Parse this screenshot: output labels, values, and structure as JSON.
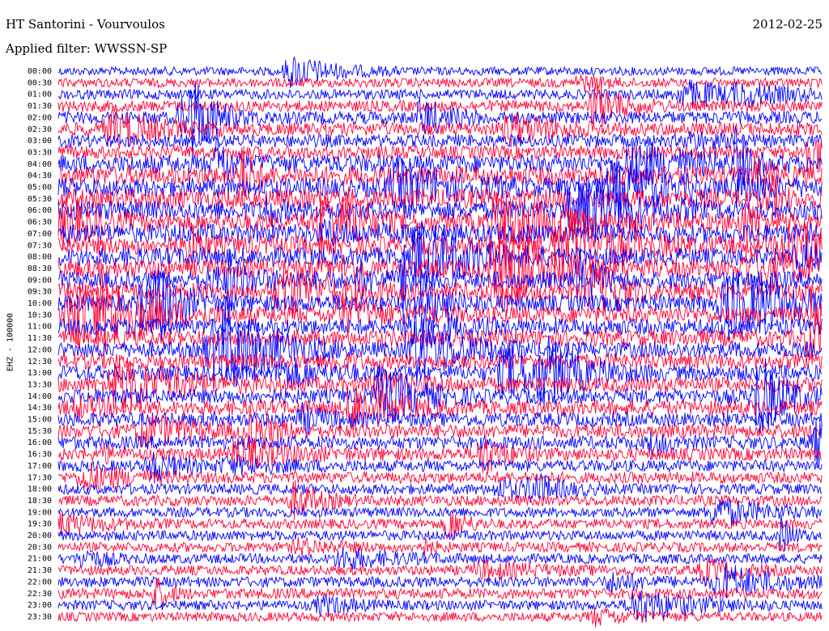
{
  "header": {
    "station": "HT Santorini - Vourvoulos",
    "date": "2012-02-25",
    "filter": "Applied filter: WWSSN-SP"
  },
  "chart_data": {
    "type": "line",
    "chart_kind": "helicorder",
    "ylabel": "EHZ - 100000",
    "colors": [
      "#0000ff",
      "#ff0033"
    ],
    "grid": false,
    "rows": [
      "00:00",
      "00:30",
      "01:00",
      "01:30",
      "02:00",
      "02:30",
      "03:00",
      "03:30",
      "04:00",
      "04:30",
      "05:00",
      "05:30",
      "06:00",
      "06:30",
      "07:00",
      "07:30",
      "08:00",
      "08:30",
      "09:00",
      "09:30",
      "10:00",
      "10:30",
      "11:00",
      "11:30",
      "12:00",
      "12:30",
      "13:00",
      "13:30",
      "14:00",
      "14:30",
      "15:00",
      "15:30",
      "16:00",
      "16:30",
      "17:00",
      "17:30",
      "18:00",
      "18:30",
      "19:00",
      "19:30",
      "20:00",
      "20:30",
      "21:00",
      "21:30",
      "22:00",
      "22:30",
      "23:00",
      "23:30"
    ],
    "row_activity": [
      0.25,
      0.3,
      0.35,
      0.45,
      0.55,
      0.6,
      0.55,
      0.6,
      0.9,
      1.0,
      1.0,
      1.0,
      1.0,
      1.0,
      1.0,
      1.0,
      0.95,
      0.95,
      0.9,
      0.9,
      0.85,
      0.85,
      0.8,
      0.8,
      0.75,
      0.75,
      0.75,
      0.7,
      0.7,
      0.7,
      0.65,
      0.65,
      0.6,
      0.55,
      0.45,
      0.45,
      0.4,
      0.4,
      0.35,
      0.35,
      0.35,
      0.35,
      0.35,
      0.35,
      0.4,
      0.4,
      0.35,
      0.3
    ]
  }
}
